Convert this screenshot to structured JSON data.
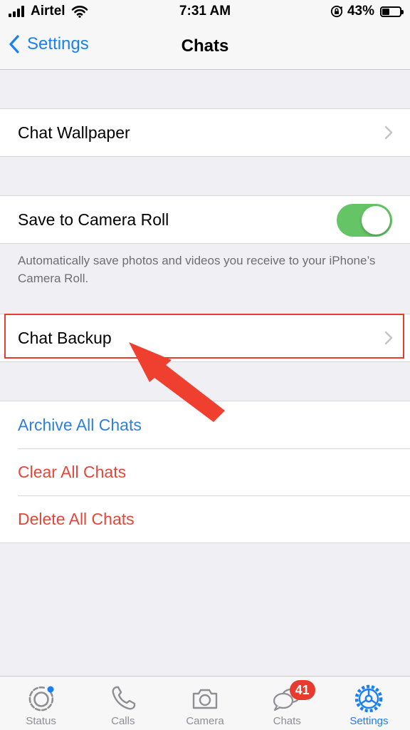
{
  "status_bar": {
    "carrier": "Airtel",
    "time": "7:31 AM",
    "battery_percent": "43%",
    "battery_level": 0.43
  },
  "nav": {
    "back_label": "Settings",
    "title": "Chats"
  },
  "chat_wallpaper": {
    "label": "Chat Wallpaper"
  },
  "camera_roll": {
    "label": "Save to Camera Roll",
    "enabled": true,
    "footnote": "Automatically save photos and videos you receive to your iPhone’s Camera Roll."
  },
  "chat_backup": {
    "label": "Chat Backup"
  },
  "actions": {
    "archive": "Archive All Chats",
    "clear": "Clear All Chats",
    "delete": "Delete All Chats"
  },
  "tabs": [
    {
      "label": "Status",
      "icon": "status-icon"
    },
    {
      "label": "Calls",
      "icon": "phone-icon"
    },
    {
      "label": "Camera",
      "icon": "camera-icon"
    },
    {
      "label": "Chats",
      "icon": "chat-bubbles-icon",
      "badge": "41"
    },
    {
      "label": "Settings",
      "icon": "gear-icon",
      "active": true
    }
  ],
  "colors": {
    "accent": "#1a7ff2",
    "destructive": "#e4473a",
    "toggle_on": "#65c466",
    "annotation": "#e63b2e"
  }
}
